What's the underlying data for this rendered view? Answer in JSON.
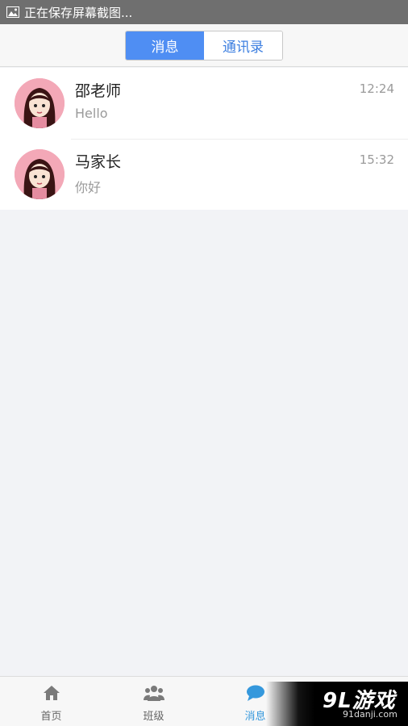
{
  "status_bar": {
    "text": "正在保存屏幕截图..."
  },
  "tabs": [
    {
      "label": "消息",
      "active": true
    },
    {
      "label": "通讯录",
      "active": false
    }
  ],
  "conversations": [
    {
      "name": "邵老师",
      "message": "Hello",
      "time": "12:24"
    },
    {
      "name": "马家长",
      "message": "你好",
      "time": "15:32"
    }
  ],
  "bottom_nav": [
    {
      "label": "首页",
      "icon": "home-icon",
      "active": false
    },
    {
      "label": "班级",
      "icon": "group-icon",
      "active": false
    },
    {
      "label": "消息",
      "icon": "chat-bubble-icon",
      "active": true
    }
  ],
  "watermark": {
    "logo": "9L游戏",
    "url": "91danji.com"
  },
  "colors": {
    "accent": "#4f8ef3",
    "nav_active": "#3598dc",
    "background": "#f2f3f6"
  }
}
